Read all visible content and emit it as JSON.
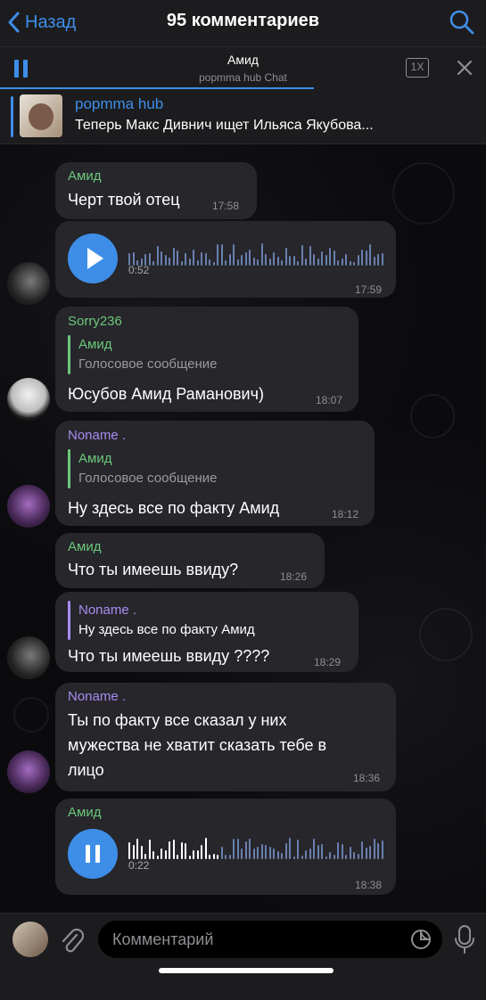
{
  "header": {
    "back_label": "Назад",
    "title": "95 комментариев"
  },
  "player": {
    "title": "Амид",
    "subtitle": "popmma hub Chat",
    "speed": "1X"
  },
  "pinned": {
    "name": "popmma hub",
    "text": "Теперь Макс Дивнич ищет Ильяса Якубова..."
  },
  "colors": {
    "accent": "#3e8ee8",
    "name_green": "#6cc87a",
    "name_purple": "#a88cf0",
    "bubble": "#26262b"
  },
  "messages": [
    {
      "sender": "Амид",
      "text": "Черт твой отец",
      "time": "17:58"
    },
    {
      "type": "voice",
      "duration": "0:52",
      "time": "17:59"
    },
    {
      "sender": "Sorry236",
      "reply_to": "Амид",
      "reply_text": "Голосовое сообщение",
      "text": "Юсубов Амид Раманович)",
      "time": "18:07"
    },
    {
      "sender": "Noname .",
      "reply_to": "Амид",
      "reply_text": "Голосовое сообщение",
      "text": "Ну здесь все по факту Амид",
      "time": "18:12"
    },
    {
      "sender": "Амид",
      "text": "Что ты имеешь ввиду?",
      "time": "18:26"
    },
    {
      "reply_to": "Noname .",
      "reply_text": "Ну здесь все по факту Амид",
      "text": "Что ты имеешь ввиду ????",
      "time": "18:29"
    },
    {
      "sender": "Noname .",
      "lines": [
        "Ты по факту все сказал у них",
        "мужества не хватит сказать тебе в",
        "лицо"
      ],
      "time": "18:36"
    },
    {
      "sender": "Амид",
      "type": "voice",
      "duration": "0:22",
      "time": "18:38"
    }
  ],
  "composer": {
    "placeholder": "Комментарий"
  },
  "icons": [
    "chevron-left-icon",
    "search-icon",
    "pause-icon",
    "close-icon",
    "play-icon",
    "attach-icon",
    "sticker-icon",
    "mic-icon"
  ]
}
